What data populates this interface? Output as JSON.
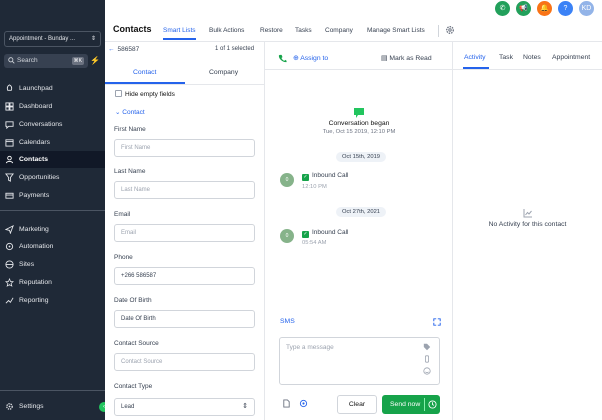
{
  "sidebar": {
    "account": "Appointment - Bunday ...",
    "search_placeholder": "Search",
    "search_shortcut": "⌘K",
    "items": [
      {
        "label": "Launchpad"
      },
      {
        "label": "Dashboard"
      },
      {
        "label": "Conversations"
      },
      {
        "label": "Calendars"
      },
      {
        "label": "Contacts"
      },
      {
        "label": "Opportunities"
      },
      {
        "label": "Payments"
      },
      {
        "label": "Marketing"
      },
      {
        "label": "Automation"
      },
      {
        "label": "Sites"
      },
      {
        "label": "Reputation"
      },
      {
        "label": "Reporting"
      }
    ],
    "settings": "Settings",
    "active_item": "Contacts"
  },
  "topbar": {
    "avatar_initials": "KD",
    "colors": {
      "phone": "#22a05b",
      "megaphone": "#22a05b",
      "bell": "#f97316",
      "help": "#3b82f6",
      "avatar": "#93b4e8"
    }
  },
  "header": {
    "title": "Contacts",
    "tabs": [
      "Smart Lists",
      "Bulk Actions",
      "Restore",
      "Tasks",
      "Company",
      "Manage Smart Lists"
    ],
    "active_tab": "Smart Lists"
  },
  "contact_panel": {
    "contact_id": "586587",
    "of_selected": "1 of 1 selected",
    "tabs": [
      "Contact",
      "Company"
    ],
    "hide_empty": "Hide empty fields",
    "section": "Contact",
    "fields": [
      {
        "label": "First Name",
        "value": "",
        "placeholder": "First Name"
      },
      {
        "label": "Last Name",
        "value": "",
        "placeholder": "Last Name"
      },
      {
        "label": "Email",
        "value": "",
        "placeholder": "Email"
      },
      {
        "label": "Phone",
        "value": "+266 586587",
        "placeholder": ""
      },
      {
        "label": "Date Of Birth",
        "value": "Date Of Birth",
        "placeholder": ""
      },
      {
        "label": "Contact Source",
        "value": "",
        "placeholder": "Contact Source"
      },
      {
        "label": "Contact Type",
        "value": "Lead",
        "placeholder": ""
      }
    ]
  },
  "conversation": {
    "assign": "Assign to",
    "mark_read": "Mark as Read",
    "started_title": "Conversation began",
    "started_date": "Tue, Oct 15 2019, 12:10 PM",
    "events": [
      {
        "date_pill": "Oct 15th, 2019",
        "avatar": "0",
        "type": "Inbound Call",
        "time": "12:10 PM"
      },
      {
        "date_pill": "Oct 27th, 2021",
        "avatar": "0",
        "type": "Inbound Call",
        "time": "05:54 AM"
      }
    ],
    "channel": "SMS",
    "composer_placeholder": "Type a message",
    "clear": "Clear",
    "send": "Send now"
  },
  "activity_panel": {
    "tabs": [
      "Activity",
      "Task",
      "Notes",
      "Appointment"
    ],
    "active_tab": "Activity",
    "empty": "No Activity for this contact"
  },
  "colors": {
    "accent": "#2563eb",
    "sidebar": "#1f2937",
    "send": "#16a34a"
  }
}
